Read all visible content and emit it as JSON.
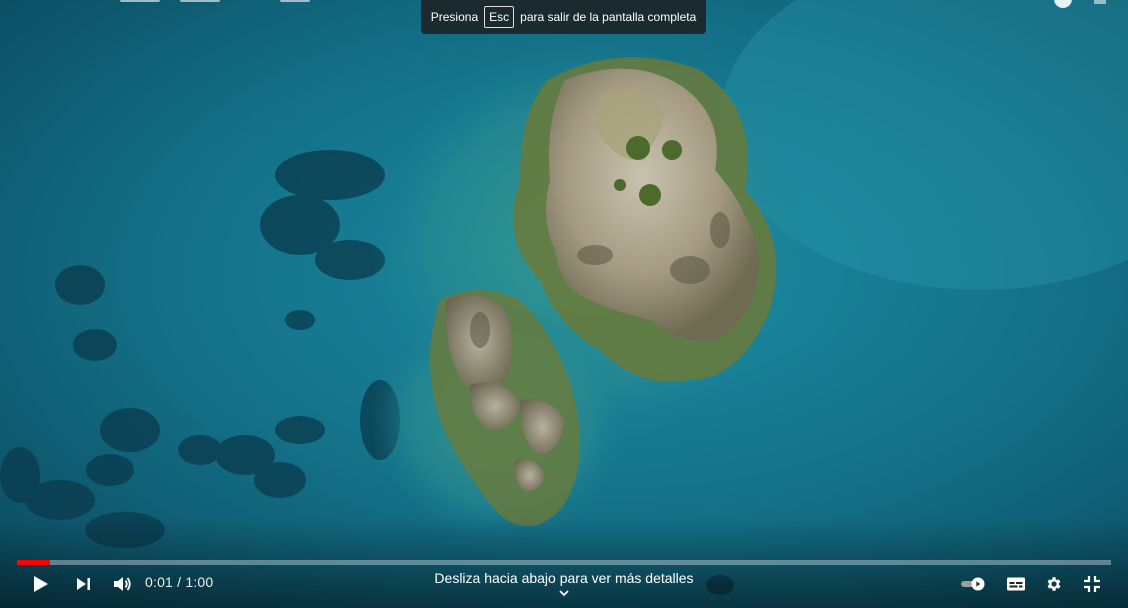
{
  "banner": {
    "before": "Presiona",
    "key": "Esc",
    "after": "para salir de la pantalla completa"
  },
  "player": {
    "progress_fraction": 0.03,
    "progress_color": "#ff0000",
    "time_current": "0:01",
    "time_separator": "/",
    "time_total": "1:00",
    "swipe_hint": "Desliza hacia abajo para ver más detalles",
    "autoplay_on": true
  },
  "icons": {
    "play": "play-icon",
    "next": "skip-next-icon",
    "volume": "volume-icon",
    "autoplay": "autoplay-toggle-icon",
    "subtitles": "subtitles-icon",
    "settings": "gear-icon",
    "exit_fullscreen": "exit-fullscreen-icon",
    "swipe": "chevron-down-icon"
  }
}
